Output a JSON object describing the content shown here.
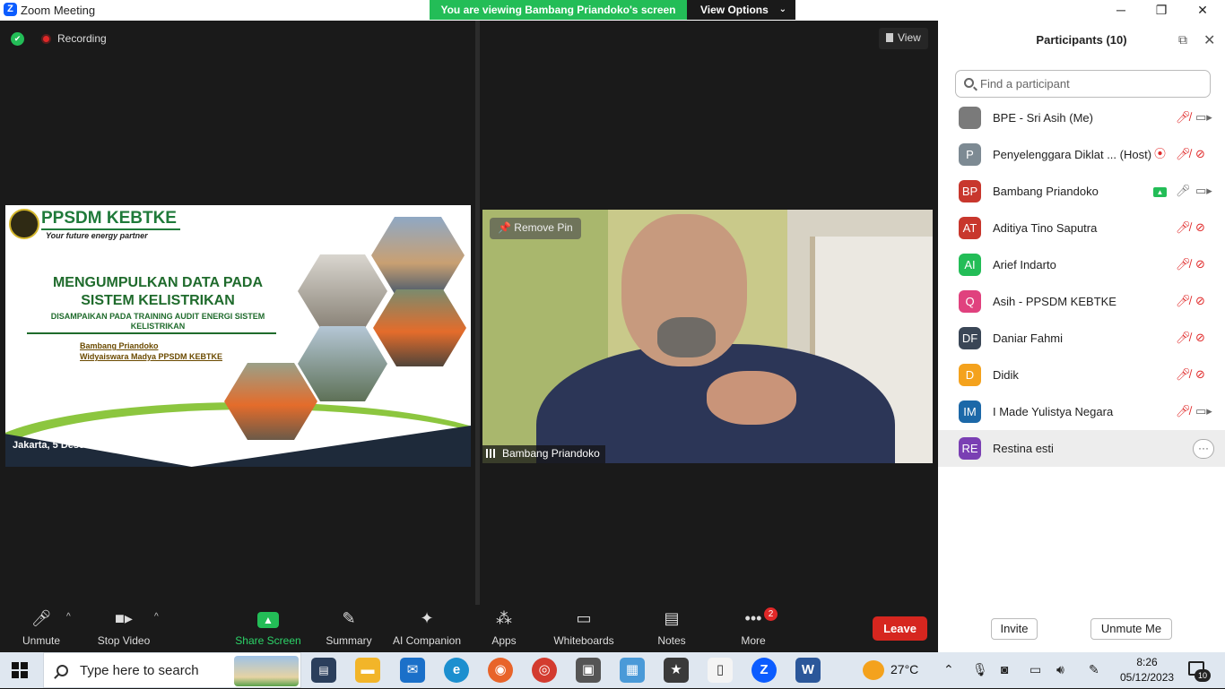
{
  "window": {
    "title": "Zoom Meeting",
    "logo": "Z",
    "min": "─",
    "max": "❐",
    "close": "✕"
  },
  "banner": {
    "message": "You are viewing Bambang Priandoko's screen",
    "view_options": "View Options",
    "chevron": "⌄"
  },
  "meeting": {
    "recording": "Recording",
    "view": "View"
  },
  "slide": {
    "brand": "PPSDM KEBTKE",
    "tagline": "Your future energy partner",
    "title_line1": "MENGUMPULKAN DATA PADA",
    "title_line2": "SISTEM KELISTRIKAN",
    "subtitle": "DISAMPAIKAN PADA TRAINING AUDIT ENERGI SISTEM KELISTRIKAN",
    "author": "Bambang Priandoko",
    "author_role": "Widyaiswara Madya PPSDM KEBTKE",
    "date": "Jakarta, 5 Desember  2023"
  },
  "video": {
    "remove_pin": "Remove Pin",
    "pin_icon": "📌",
    "name": "Bambang Priandoko"
  },
  "toolbar": {
    "unmute": "Unmute",
    "stop_video": "Stop Video",
    "share_screen": "Share Screen",
    "summary": "Summary",
    "ai_companion": "AI Companion",
    "apps": "Apps",
    "whiteboards": "Whiteboards",
    "notes": "Notes",
    "more": "More",
    "more_badge": "2",
    "leave": "Leave",
    "caret": "^"
  },
  "participants": {
    "title": "Participants (10)",
    "search_placeholder": "Find a participant",
    "invite": "Invite",
    "unmute_me": "Unmute Me",
    "list": [
      {
        "initials": "",
        "name": "BPE - Sri Asih (Me)",
        "color": "#7a7a7a",
        "mic": "muted",
        "cam": "on"
      },
      {
        "initials": "P",
        "name": "Penyelenggara Diklat ...  (Host)",
        "color": "#7d8a93",
        "mic": "muted",
        "cam": "off",
        "recording": true
      },
      {
        "initials": "BP",
        "name": "Bambang Priandoko",
        "color": "#c8372d",
        "mic": "on",
        "cam": "on",
        "sharing": true
      },
      {
        "initials": "AT",
        "name": "Aditiya Tino Saputra",
        "color": "#c8372d",
        "mic": "muted",
        "cam": "off"
      },
      {
        "initials": "AI",
        "name": "Arief Indarto",
        "color": "#23bd57",
        "mic": "muted",
        "cam": "off"
      },
      {
        "initials": "Q",
        "name": "Asih - PPSDM KEBTKE",
        "color": "#e0417e",
        "mic": "muted",
        "cam": "off"
      },
      {
        "initials": "DF",
        "name": "Daniar Fahmi",
        "color": "#3a4656",
        "mic": "muted",
        "cam": "off"
      },
      {
        "initials": "D",
        "name": "Didik",
        "color": "#f4a21d",
        "mic": "muted",
        "cam": "off"
      },
      {
        "initials": "IM",
        "name": "I Made Yulistya Negara",
        "color": "#1c68a8",
        "mic": "muted",
        "cam": "on"
      },
      {
        "initials": "RE",
        "name": "Restina esti",
        "color": "#7a3fb3",
        "mic": "",
        "cam": "",
        "highlighted": true
      }
    ]
  },
  "taskbar": {
    "search_placeholder": "Type here to search",
    "temperature": "27°C",
    "time": "8:26",
    "date": "05/12/2023",
    "notifications": "10"
  },
  "colors": {
    "zoom_blue": "#0b5cff",
    "green": "#23bd57",
    "leave_red": "#d6261f"
  }
}
